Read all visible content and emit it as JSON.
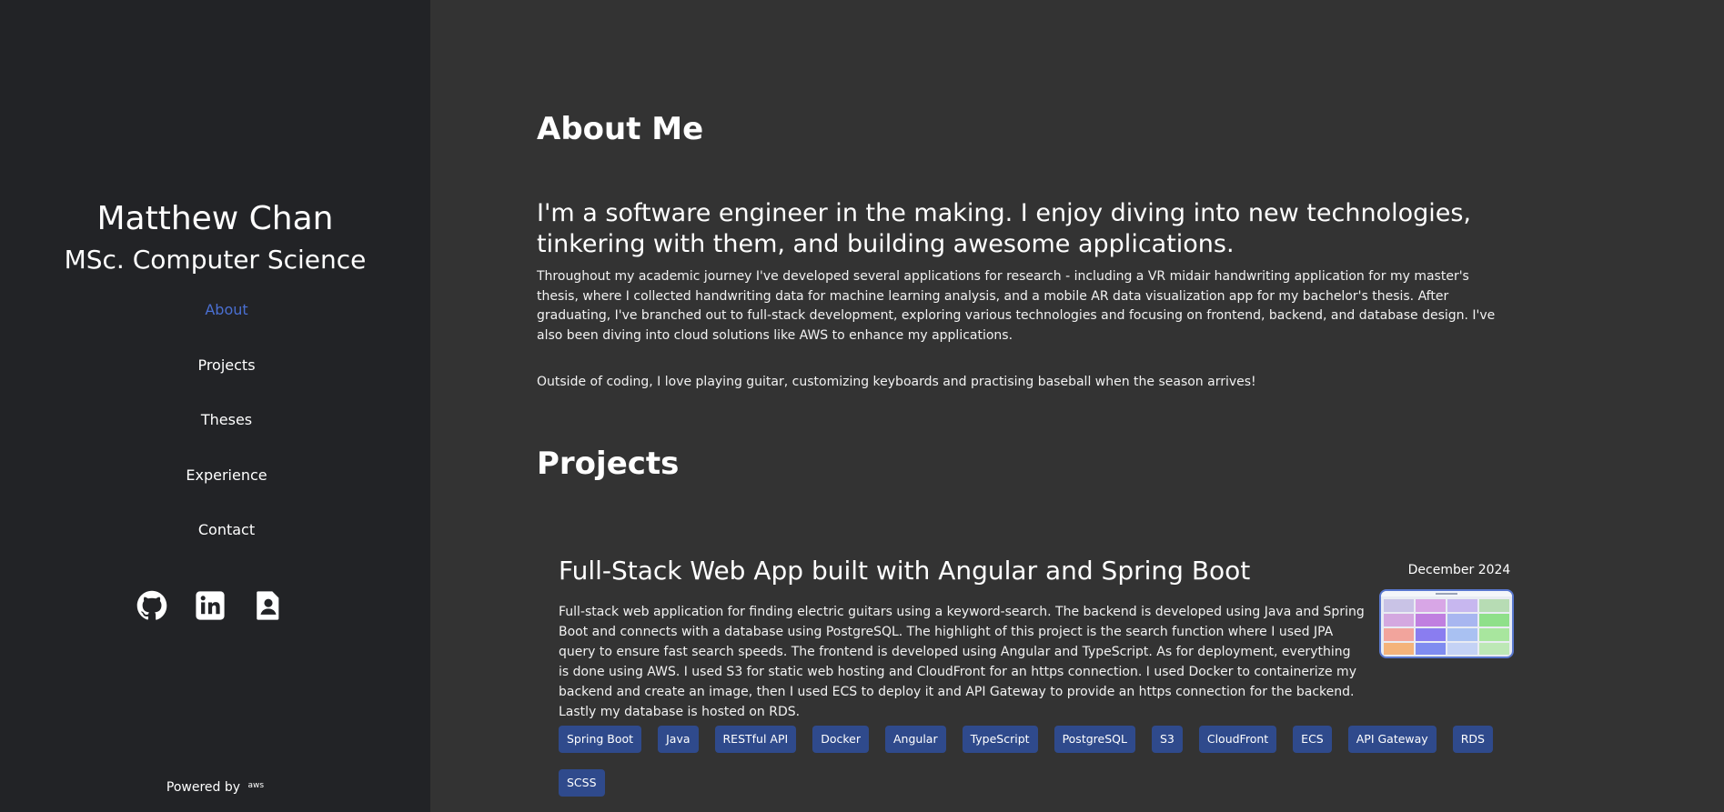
{
  "sidebar": {
    "name": "Matthew Chan",
    "degree": "MSc. Computer Science",
    "nav": [
      {
        "label": "About",
        "active": true
      },
      {
        "label": "Projects",
        "active": false
      },
      {
        "label": "Theses",
        "active": false
      },
      {
        "label": "Experience",
        "active": false
      },
      {
        "label": "Contact",
        "active": false
      }
    ],
    "socials": [
      "github-icon",
      "linkedin-icon",
      "resume-icon"
    ],
    "powered_by": "Powered by",
    "powered_logo": "aws"
  },
  "about": {
    "heading": "About Me",
    "lead": "I'm a software engineer in the making. I enjoy diving into new technologies, tinkering with them, and building awesome applications.",
    "body": "Throughout my academic journey I've developed several applications for research - including a VR midair handwriting application for my master's thesis, where I collected handwriting data for machine learning analysis, and a mobile AR data visualization app for my bachelor's thesis. After graduating, I've branched out to full-stack development, exploring various technologies and focusing on frontend, backend, and database design. I've also been diving into cloud solutions like AWS to enhance my applications.",
    "extra": "Outside of coding, I love playing guitar, customizing keyboards and practising baseball when the season arrives!"
  },
  "projects": {
    "heading": "Projects",
    "items": [
      {
        "title": "Full-Stack Web App built with Angular and Spring Boot",
        "date": "December 2024",
        "description": "Full-stack web application for finding electric guitars using a keyword-search. The backend is developed using Java and Spring Boot and connects with a database using PostgreSQL. The highlight of this project is the search function where I used JPA query to ensure fast search speeds. The frontend is developed using Angular and TypeScript. As for deployment, everything is done using AWS. I used S3 for static web hosting and CloudFront for an https connection. I used Docker to containerize my backend and create an image, then I used ECS to deploy it and API Gateway to provide an https connection for the backend. Lastly my database is hosted on RDS.",
        "tags": [
          "Spring Boot",
          "Java",
          "RESTful API",
          "Docker",
          "Angular",
          "TypeScript",
          "PostgreSQL",
          "S3",
          "CloudFront",
          "ECS",
          "API Gateway",
          "RDS",
          "SCSS"
        ]
      }
    ]
  },
  "colors": {
    "sidebar_bg": "#222326",
    "main_bg": "#333333",
    "accent": "#4a6fd1",
    "tag_bg": "#2f4a8c"
  }
}
